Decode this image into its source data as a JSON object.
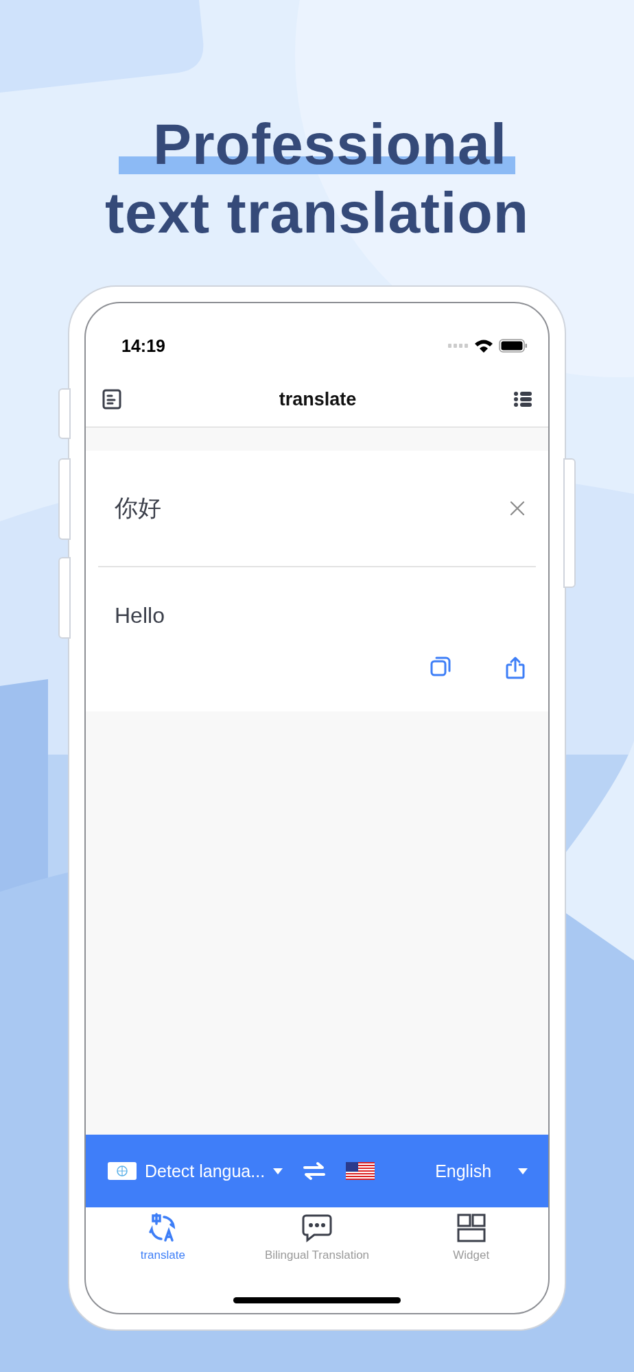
{
  "headline": {
    "line_1": "Professional",
    "line_2": "text translation"
  },
  "status_bar": {
    "time": "14:19"
  },
  "nav": {
    "title": "translate"
  },
  "source": {
    "text": "你好"
  },
  "result": {
    "text": "Hello"
  },
  "language_bar": {
    "source": "Detect langua...",
    "target": "English"
  },
  "tabs": [
    {
      "label": "translate",
      "selected": true,
      "kind": "translate"
    },
    {
      "label": "Bilingual Translation",
      "selected": false,
      "kind": "chat"
    },
    {
      "label": "Widget",
      "selected": false,
      "kind": "widget"
    }
  ]
}
